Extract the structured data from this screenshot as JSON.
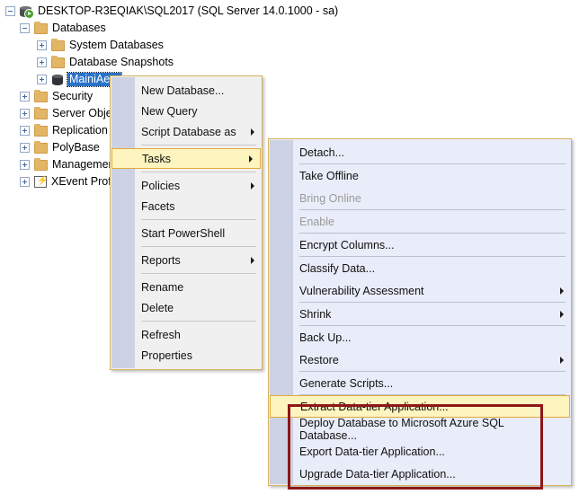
{
  "tree": {
    "items": [
      {
        "label": "DESKTOP-R3EQIAK\\SQL2017 (SQL Server 14.0.1000 - sa)",
        "icon": "server-icon",
        "expander": "minus",
        "indent": 0,
        "selected": false
      },
      {
        "label": "Databases",
        "icon": "folder-icon",
        "expander": "minus",
        "indent": 1,
        "selected": false
      },
      {
        "label": "System Databases",
        "icon": "folder-icon",
        "expander": "plus",
        "indent": 2,
        "selected": false
      },
      {
        "label": "Database Snapshots",
        "icon": "folder-icon",
        "expander": "plus",
        "indent": 2,
        "selected": false
      },
      {
        "label": "MainiAero",
        "icon": "database-icon",
        "expander": "plus",
        "indent": 2,
        "selected": true
      },
      {
        "label": "Security",
        "icon": "folder-icon",
        "expander": "plus",
        "indent": 1,
        "selected": false
      },
      {
        "label": "Server Objects",
        "icon": "folder-icon",
        "expander": "plus",
        "indent": 1,
        "selected": false
      },
      {
        "label": "Replication",
        "icon": "folder-icon",
        "expander": "plus",
        "indent": 1,
        "selected": false
      },
      {
        "label": "PolyBase",
        "icon": "folder-icon",
        "expander": "plus",
        "indent": 1,
        "selected": false
      },
      {
        "label": "Management",
        "icon": "folder-icon",
        "expander": "plus",
        "indent": 1,
        "selected": false
      },
      {
        "label": "XEvent Profiler",
        "icon": "xevent-icon",
        "expander": "plus",
        "indent": 1,
        "selected": false
      }
    ]
  },
  "context_menu": {
    "items": [
      {
        "label": "New Database...",
        "submenu": false,
        "highlighted": false,
        "disabled": false
      },
      {
        "label": "New Query",
        "submenu": false,
        "highlighted": false,
        "disabled": false
      },
      {
        "label": "Script Database as",
        "submenu": true,
        "highlighted": false,
        "disabled": false
      },
      {
        "separator": true
      },
      {
        "label": "Tasks",
        "submenu": true,
        "highlighted": true,
        "disabled": false
      },
      {
        "separator": true
      },
      {
        "label": "Policies",
        "submenu": true,
        "highlighted": false,
        "disabled": false
      },
      {
        "label": "Facets",
        "submenu": false,
        "highlighted": false,
        "disabled": false
      },
      {
        "separator": true
      },
      {
        "label": "Start PowerShell",
        "submenu": false,
        "highlighted": false,
        "disabled": false
      },
      {
        "separator": true
      },
      {
        "label": "Reports",
        "submenu": true,
        "highlighted": false,
        "disabled": false
      },
      {
        "separator": true
      },
      {
        "label": "Rename",
        "submenu": false,
        "highlighted": false,
        "disabled": false
      },
      {
        "label": "Delete",
        "submenu": false,
        "highlighted": false,
        "disabled": false
      },
      {
        "separator": true
      },
      {
        "label": "Refresh",
        "submenu": false,
        "highlighted": false,
        "disabled": false
      },
      {
        "label": "Properties",
        "submenu": false,
        "highlighted": false,
        "disabled": false
      }
    ]
  },
  "tasks_submenu": {
    "items": [
      {
        "label": "Detach...",
        "submenu": false,
        "highlighted": false,
        "disabled": false
      },
      {
        "separator": true
      },
      {
        "label": "Take Offline",
        "submenu": false,
        "highlighted": false,
        "disabled": false
      },
      {
        "label": "Bring Online",
        "submenu": false,
        "highlighted": false,
        "disabled": true
      },
      {
        "separator": true
      },
      {
        "label": "Enable",
        "submenu": false,
        "highlighted": false,
        "disabled": true
      },
      {
        "separator": true
      },
      {
        "label": "Encrypt Columns...",
        "submenu": false,
        "highlighted": false,
        "disabled": false
      },
      {
        "separator": true
      },
      {
        "label": "Classify Data...",
        "submenu": false,
        "highlighted": false,
        "disabled": false
      },
      {
        "label": "Vulnerability Assessment",
        "submenu": true,
        "highlighted": false,
        "disabled": false
      },
      {
        "separator": true
      },
      {
        "label": "Shrink",
        "submenu": true,
        "highlighted": false,
        "disabled": false
      },
      {
        "separator": true
      },
      {
        "label": "Back Up...",
        "submenu": false,
        "highlighted": false,
        "disabled": false
      },
      {
        "label": "Restore",
        "submenu": true,
        "highlighted": false,
        "disabled": false
      },
      {
        "separator": true
      },
      {
        "label": "Generate Scripts...",
        "submenu": false,
        "highlighted": false,
        "disabled": false
      },
      {
        "separator": true
      },
      {
        "label": "Extract Data-tier Application...",
        "submenu": false,
        "highlighted": true,
        "disabled": false
      },
      {
        "label": "Deploy Database to Microsoft Azure SQL Database...",
        "submenu": false,
        "highlighted": false,
        "disabled": false
      },
      {
        "label": "Export Data-tier Application...",
        "submenu": false,
        "highlighted": false,
        "disabled": false
      },
      {
        "label": "Upgrade Data-tier Application...",
        "submenu": false,
        "highlighted": false,
        "disabled": false
      }
    ]
  },
  "annotation": {
    "highlight_color": "#8e1717",
    "menu_highlight_color": "#fdf4bf",
    "selection_color": "#2a72c9"
  }
}
